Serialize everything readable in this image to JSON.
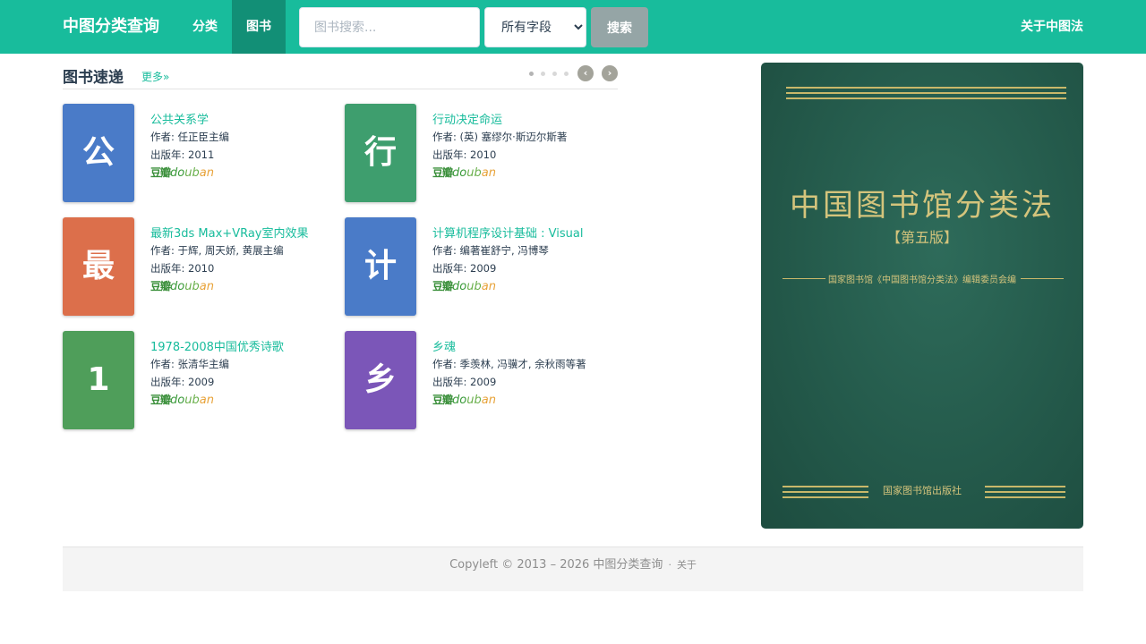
{
  "navbar": {
    "brand": "中图分类查询",
    "links": [
      {
        "label": "分类"
      },
      {
        "label": "图书"
      }
    ],
    "search": {
      "placeholder": "图书搜索...",
      "value": "",
      "field_selected": "所有字段",
      "button_label": "搜索"
    },
    "about": "关于中图法",
    "color": "#18bc9c"
  },
  "books_section": {
    "title": "图书速递",
    "more": "更多»",
    "carousel": {
      "active_page": 1,
      "page_count": 4,
      "prev_icon": "‹",
      "next_icon": "›"
    },
    "author_prefix": "作者: ",
    "year_prefix": "出版年: ",
    "douban": {
      "d1": "豆瓣",
      "d2": "do",
      "d3": "ub",
      "d4": "an"
    },
    "books": [
      {
        "initial": "公",
        "title": "公共关系学",
        "author": "任正臣主编",
        "year": "2011",
        "cover_color": "#4a7bc8"
      },
      {
        "initial": "行",
        "title": "行动决定命运",
        "author": "(英) 塞缪尔·斯迈尔斯著",
        "year": "2010",
        "cover_color": "#3e9e6e"
      },
      {
        "initial": "最",
        "title": "最新3ds Max+VRay室内效果",
        "author": "于辉, 周天娇, 黄展主编",
        "year": "2010",
        "cover_color": "#dc6f4b"
      },
      {
        "initial": "计",
        "title": "计算机程序设计基础 : Visual",
        "author": "编著崔舒宁, 冯博琴",
        "year": "2009",
        "cover_color": "#4a7bc8"
      },
      {
        "initial": "1",
        "title": "1978-2008中国优秀诗歌",
        "author": "张清华主编",
        "year": "2009",
        "cover_color": "#4f9e5a"
      },
      {
        "initial": "乡",
        "title": "乡魂",
        "author": "季羡林, 冯骥才, 余秋雨等著",
        "year": "2009",
        "cover_color": "#7b56b8"
      }
    ]
  },
  "cover_image": {
    "title": "中国图书馆分类法",
    "edition": "【第五版】",
    "editor": "国家图书馆《中国图书馆分类法》编辑委员会编",
    "publisher": "国家图书馆出版社"
  },
  "footer": {
    "copyright": "Copyleft © 2013 – 2026 中图分类查询",
    "separator": "·",
    "about": "关于"
  }
}
